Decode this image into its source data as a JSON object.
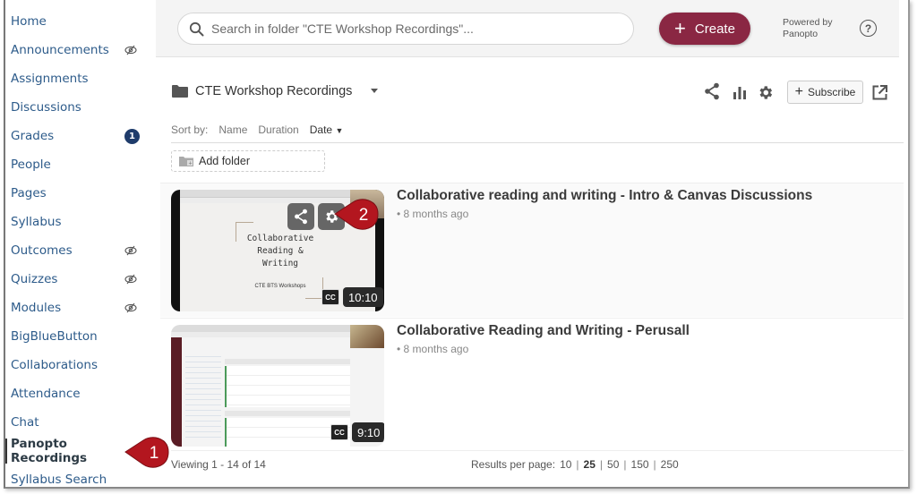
{
  "sidebar": {
    "items": [
      {
        "label": "Home",
        "hidden": false,
        "badge": null,
        "active": false
      },
      {
        "label": "Announcements",
        "hidden": true,
        "badge": null,
        "active": false
      },
      {
        "label": "Assignments",
        "hidden": false,
        "badge": null,
        "active": false
      },
      {
        "label": "Discussions",
        "hidden": false,
        "badge": null,
        "active": false
      },
      {
        "label": "Grades",
        "hidden": false,
        "badge": "1",
        "active": false
      },
      {
        "label": "People",
        "hidden": false,
        "badge": null,
        "active": false
      },
      {
        "label": "Pages",
        "hidden": false,
        "badge": null,
        "active": false
      },
      {
        "label": "Syllabus",
        "hidden": false,
        "badge": null,
        "active": false
      },
      {
        "label": "Outcomes",
        "hidden": true,
        "badge": null,
        "active": false
      },
      {
        "label": "Quizzes",
        "hidden": true,
        "badge": null,
        "active": false
      },
      {
        "label": "Modules",
        "hidden": true,
        "badge": null,
        "active": false
      },
      {
        "label": "BigBlueButton",
        "hidden": false,
        "badge": null,
        "active": false
      },
      {
        "label": "Collaborations",
        "hidden": false,
        "badge": null,
        "active": false
      },
      {
        "label": "Attendance",
        "hidden": false,
        "badge": null,
        "active": false
      },
      {
        "label": "Chat",
        "hidden": false,
        "badge": null,
        "active": false
      },
      {
        "label": "Panopto Recordings",
        "hidden": false,
        "badge": null,
        "active": true
      },
      {
        "label": "Syllabus Search",
        "hidden": false,
        "badge": null,
        "active": false
      }
    ]
  },
  "header": {
    "search_placeholder": "Search in folder \"CTE Workshop Recordings\"...",
    "create_label": "Create",
    "powered_by_line1": "Powered by",
    "powered_by_line2": "Panopto",
    "help_label": "?",
    "brand_color": "#8a2743"
  },
  "folder": {
    "name": "CTE Workshop Recordings",
    "subscribe_label": "Subscribe",
    "icons": [
      "share-icon",
      "stats-icon",
      "settings-icon",
      "open-new-window-icon"
    ]
  },
  "sort": {
    "label": "Sort by:",
    "options": [
      "Name",
      "Duration",
      "Date"
    ],
    "selected": "Date"
  },
  "add_folder_label": "Add folder",
  "sessions": [
    {
      "title": "Collaborative reading and writing - Intro & Canvas Discussions",
      "date": "8 months ago",
      "duration": "10:10",
      "cc": "CC",
      "thumb_text": [
        "Collaborative",
        "Reading &",
        "Writing"
      ],
      "thumb_subtext": "CTE BTS Workshops"
    },
    {
      "title": "Collaborative Reading and Writing - Perusall",
      "date": "8 months ago",
      "duration": "9:10",
      "cc": "CC"
    }
  ],
  "footer": {
    "viewing": "Viewing 1 - 14 of 14",
    "results_label": "Results per page:",
    "page_sizes": [
      "10",
      "25",
      "50",
      "150",
      "250"
    ],
    "current_page_size": "25"
  },
  "callouts": {
    "one": "1",
    "two": "2",
    "color": "#b3161f"
  }
}
